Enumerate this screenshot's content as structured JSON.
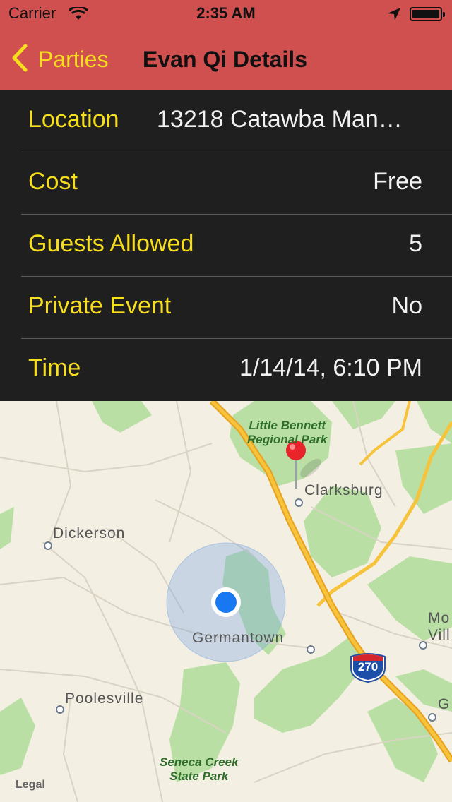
{
  "status_bar": {
    "carrier": "Carrier",
    "time": "2:35 AM"
  },
  "nav": {
    "back_label": "Parties",
    "title": "Evan Qi Details"
  },
  "details": [
    {
      "key": "Location",
      "value": "13218 Catawba Man…"
    },
    {
      "key": "Cost",
      "value": "Free"
    },
    {
      "key": "Guests Allowed",
      "value": "5"
    },
    {
      "key": "Private Event",
      "value": "No"
    },
    {
      "key": "Time",
      "value": "1/14/14, 6:10 PM"
    }
  ],
  "map": {
    "places": {
      "clarksburg": "Clarksburg",
      "dickerson": "Dickerson",
      "germantown": "Germantown",
      "poolesville": "Poolesville",
      "mo": "Mo",
      "vill": "Vill",
      "g": "G"
    },
    "parks": {
      "little_bennett_1": "Little Bennett",
      "little_bennett_2": "Regional Park",
      "seneca_1": "Seneca Creek",
      "seneca_2": "State Park"
    },
    "highway_shield": "270",
    "legal": "Legal"
  },
  "colors": {
    "bar": "#d04f4f",
    "accent": "#f6de1c",
    "table_bg": "#1f1f1f",
    "map_bg": "#f4efe3"
  }
}
